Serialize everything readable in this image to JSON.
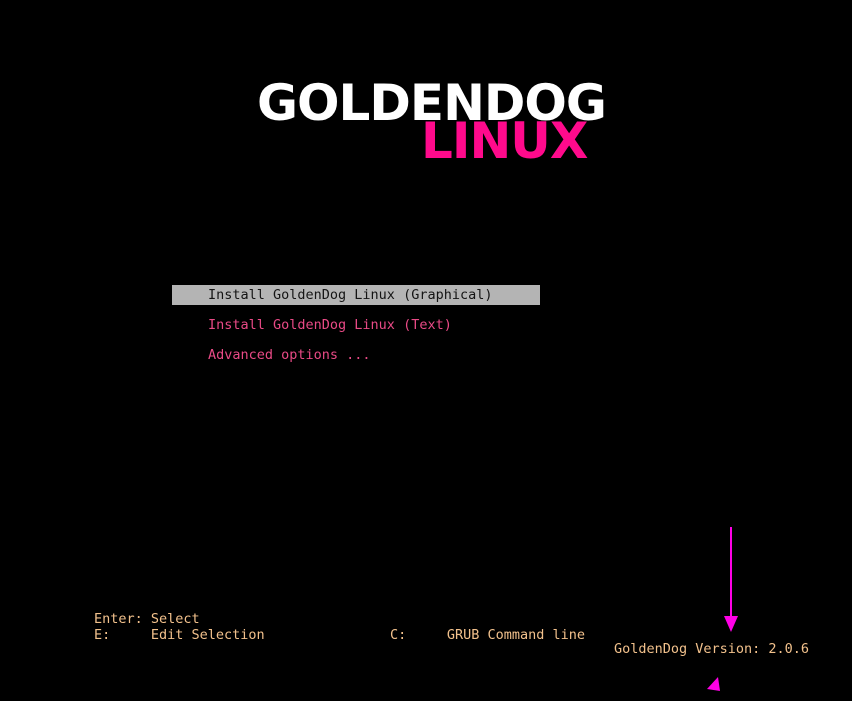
{
  "logo": {
    "line1": "GOLDENDOG",
    "line2": "LINUX",
    "primary_color": "#ffffff",
    "accent_color": "#ff0a8c"
  },
  "menu": {
    "items": [
      {
        "label": "Install GoldenDog Linux (Graphical)",
        "selected": true
      },
      {
        "label": "Install GoldenDog Linux (Text)",
        "selected": false
      },
      {
        "label": "Advanced options ...",
        "selected": false
      }
    ]
  },
  "help": {
    "enter": "Enter: Select",
    "edit": "E:     Edit Selection",
    "command": "C:     GRUB Command line"
  },
  "footer": {
    "version": "GoldenDog Version: 2.0.6"
  },
  "colors": {
    "background": "#000000",
    "menu_text": "#e94a86",
    "selected_bg": "#b4b4b4",
    "selected_text": "#141414",
    "help_text": "#f2c18c",
    "annotation": "#ff00e6"
  },
  "annotations": {
    "arrow_icon": "arrow-down-icon",
    "pointer_icon": "triangle-pointer-icon"
  }
}
